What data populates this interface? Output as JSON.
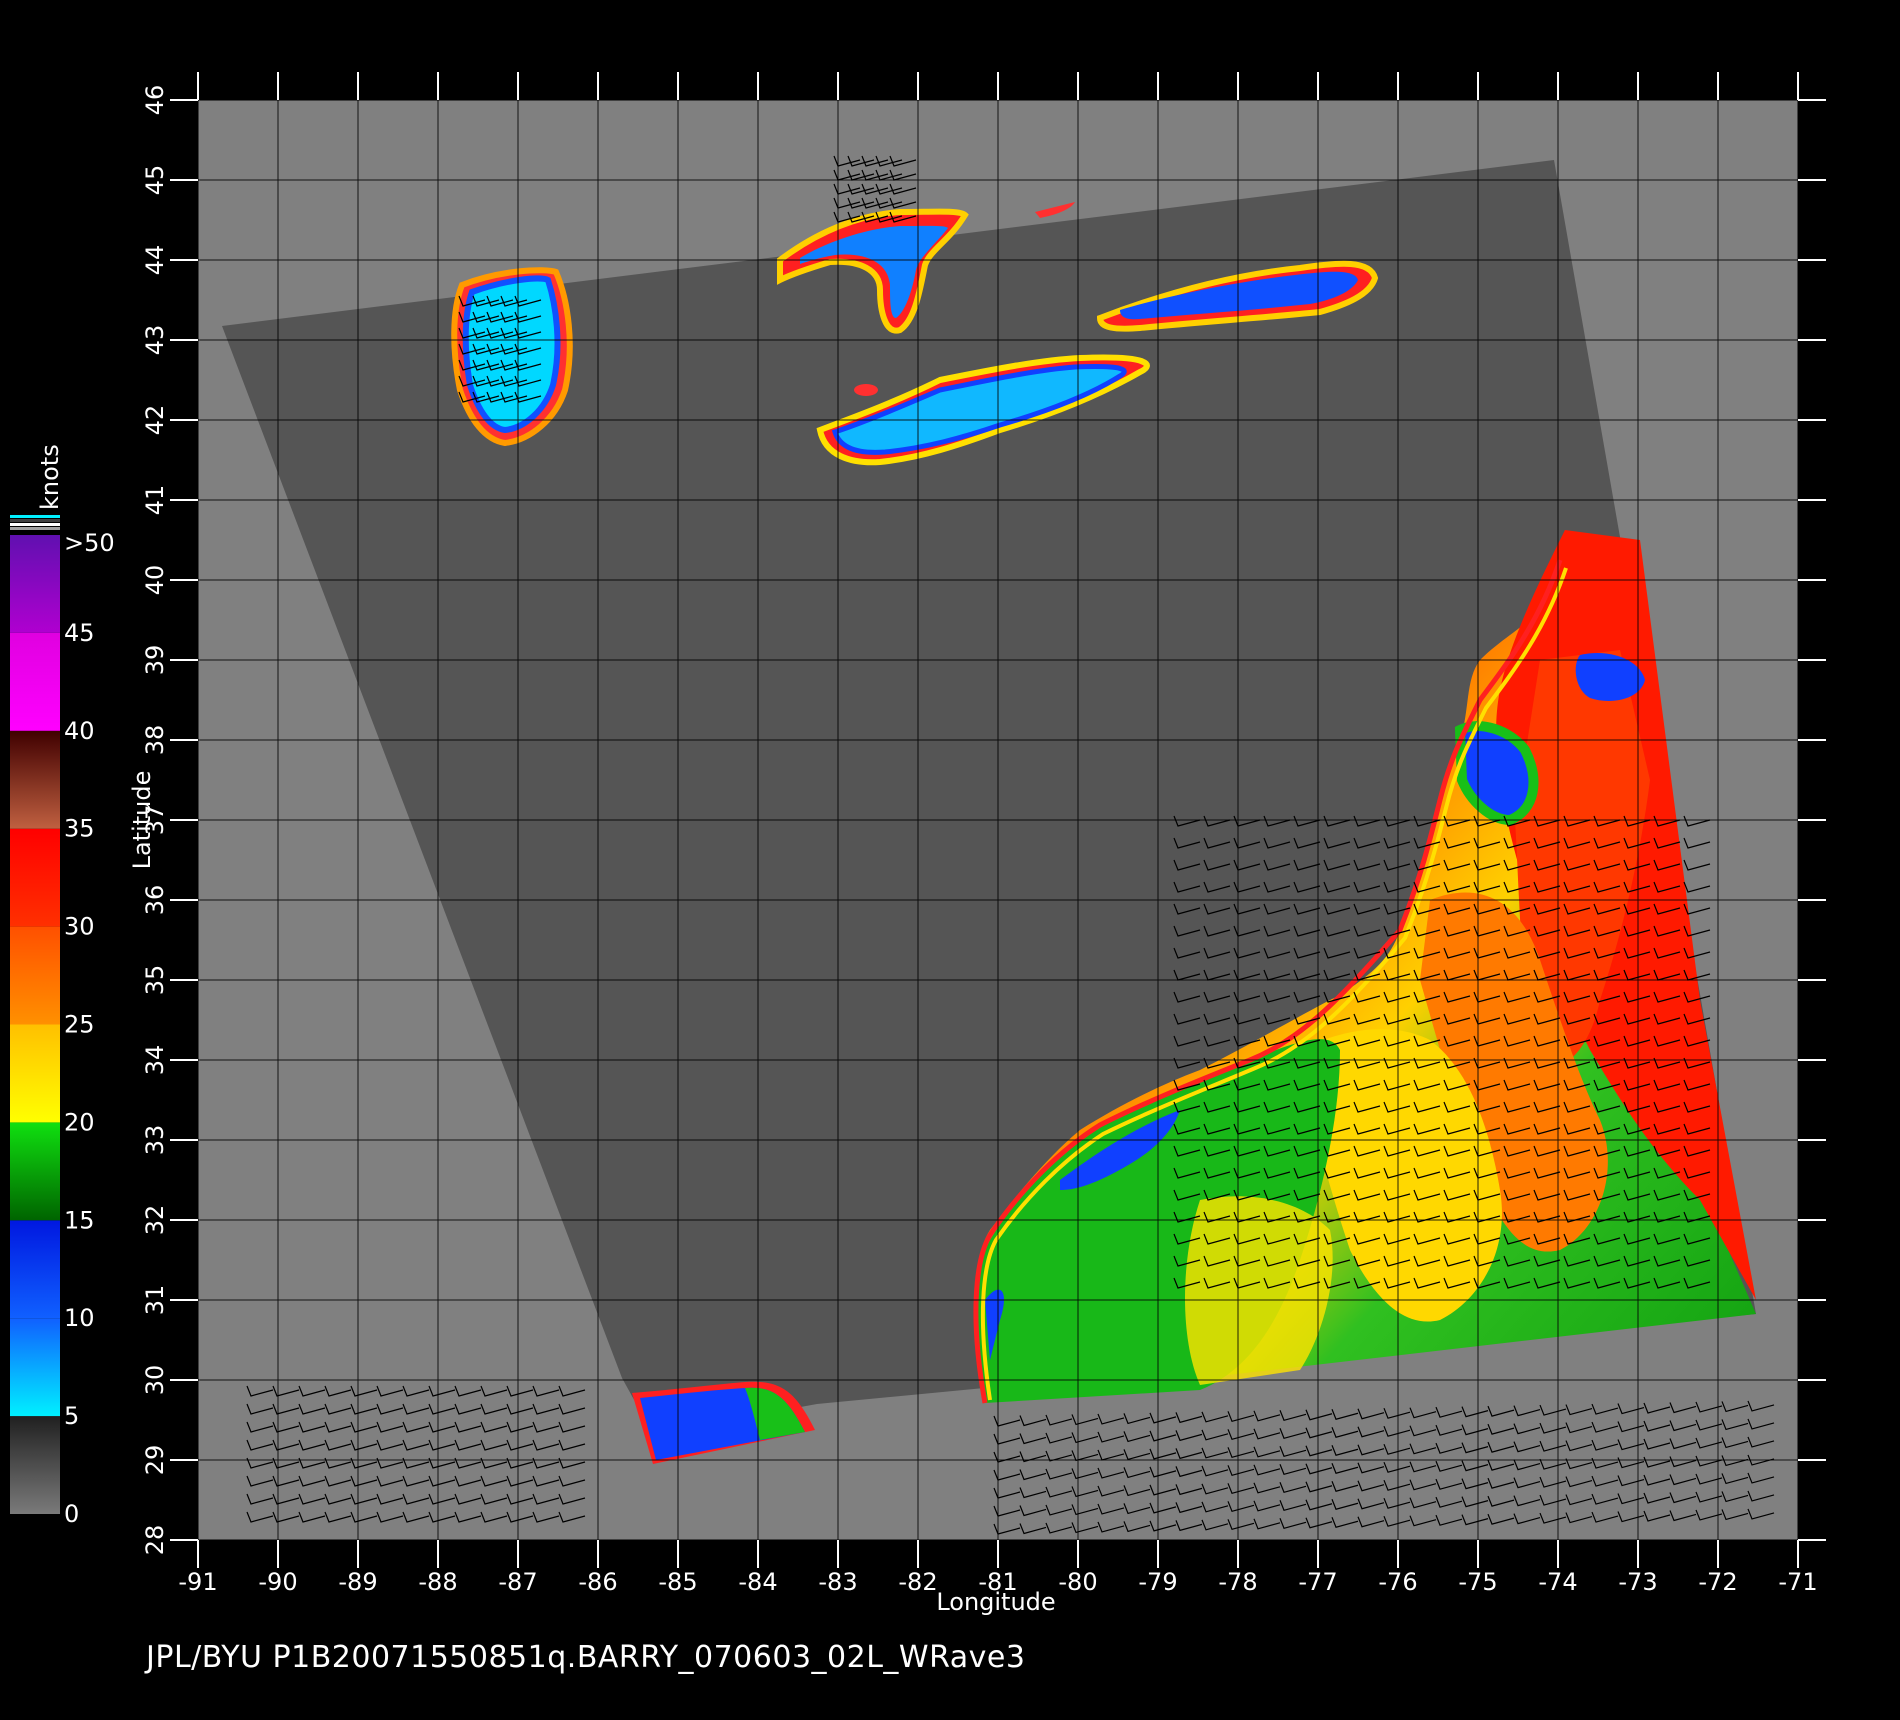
{
  "map": {
    "lon_range": [
      -91,
      -71
    ],
    "lat_range": [
      28,
      46
    ],
    "grid": true,
    "background_color": "#808080",
    "swath_color": "#555555",
    "land_outside_color": "#808080",
    "wind_barbs": true
  },
  "axes": {
    "x_label": "Longitude",
    "y_label": "Latitude",
    "x_ticks": [
      "-91",
      "-90",
      "-89",
      "-88",
      "-87",
      "-86",
      "-85",
      "-84",
      "-83",
      "-82",
      "-81",
      "-80",
      "-79",
      "-78",
      "-77",
      "-76",
      "-75",
      "-74",
      "-73",
      "-72",
      "-71"
    ],
    "y_ticks": [
      "28",
      "29",
      "30",
      "31",
      "32",
      "33",
      "34",
      "35",
      "36",
      "37",
      "38",
      "39",
      "40",
      "41",
      "42",
      "43",
      "44",
      "45",
      "46"
    ]
  },
  "colorbar": {
    "title": "knots",
    "labels": [
      "0",
      "5",
      "10",
      "15",
      "20",
      "25",
      "30",
      "35",
      "40",
      "45",
      ">50"
    ],
    "segments": [
      {
        "from": 0,
        "to": 5,
        "colors": [
          "#7a7a7a",
          "#202020"
        ]
      },
      {
        "from": 5,
        "to": 10,
        "colors": [
          "#00f0ff",
          "#1060ff"
        ]
      },
      {
        "from": 10,
        "to": 15,
        "colors": [
          "#1060ff",
          "#0018e0"
        ]
      },
      {
        "from": 15,
        "to": 20,
        "colors": [
          "#006400",
          "#10e010"
        ]
      },
      {
        "from": 20,
        "to": 25,
        "colors": [
          "#ffff00",
          "#ffc000"
        ]
      },
      {
        "from": 25,
        "to": 30,
        "colors": [
          "#ff9000",
          "#ff5000"
        ]
      },
      {
        "from": 30,
        "to": 35,
        "colors": [
          "#ff3000",
          "#ff0000"
        ]
      },
      {
        "from": 35,
        "to": 40,
        "colors": [
          "#c06040",
          "#400000"
        ]
      },
      {
        "from": 40,
        "to": 45,
        "colors": [
          "#ff00ff",
          "#e000e0"
        ]
      },
      {
        "from": 45,
        "to": 50,
        "colors": [
          "#b000d0",
          "#6010b0"
        ]
      }
    ]
  },
  "caption": "JPL/BYU  P1B20071550851q.BARRY_070603_02L_WRave3"
}
